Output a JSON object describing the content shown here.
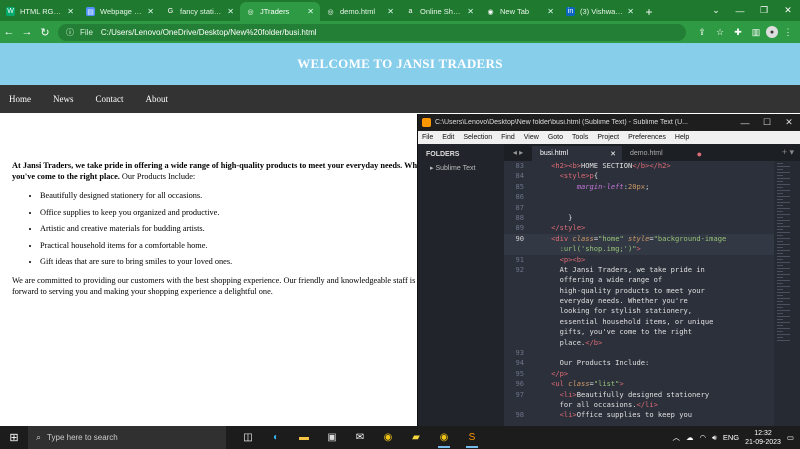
{
  "browser": {
    "tabs": [
      {
        "title": "HTML RGB an",
        "icon": "w3schools-icon",
        "color": "#04aa6d",
        "glyph": "W"
      },
      {
        "title": "Webpage Cre",
        "icon": "doc-icon",
        "color": "#4d90fe",
        "glyph": "▤"
      },
      {
        "title": "fancy statione",
        "icon": "google-icon",
        "color": "#ffffff",
        "glyph": "G"
      },
      {
        "title": "JTraders",
        "icon": "globe-icon",
        "color": "#ffffff",
        "glyph": "◎",
        "active": true
      },
      {
        "title": "demo.html",
        "icon": "globe-icon",
        "color": "#ffffff",
        "glyph": "◎"
      },
      {
        "title": "Online Shopp",
        "icon": "amazon-icon",
        "color": "#ffffff",
        "glyph": "a"
      },
      {
        "title": "New Tab",
        "icon": "chrome-icon",
        "color": "#ffffff",
        "glyph": "◉"
      },
      {
        "title": "(3) Vishwa Ja",
        "icon": "linkedin-icon",
        "color": "#0a66c2",
        "glyph": "in"
      }
    ],
    "new_tab": "+",
    "address": {
      "scheme_label": "File",
      "url": "C:/Users/Lenovo/OneDrive/Desktop/New%20folder/busi.html"
    }
  },
  "site": {
    "banner": "WELCOME TO JANSI TRADERS",
    "nav": [
      "Home",
      "News",
      "Contact",
      "About"
    ],
    "intro_bold": "At Jansi Traders, we take pride in offering a wide range of high-quality products to meet your everyday needs. Whether you're looking for stylish stationery, essential household items, or unique gifts, you've come to the right place.",
    "intro_plain": " Our Products Include:",
    "products": [
      "Beautifully designed stationery for all occasions.",
      "Office supplies to keep you organized and productive.",
      "Artistic and creative materials for budding artists.",
      "Practical household items for a comfortable home.",
      "Gift ideas that are sure to bring smiles to your loved ones."
    ],
    "outro": "We are committed to providing our customers with the best shopping experience. Our friendly and knowledgeable staff is always ready to assist you. Come and explore our diverse selection of products. We look forward to serving you and making your shopping experience a delightful one."
  },
  "editor": {
    "title": "C:\\Users\\Lenovo\\Desktop\\New folder\\busi.html (Sublime Text) - Sublime Text (U...",
    "menu": [
      "File",
      "Edit",
      "Selection",
      "Find",
      "View",
      "Goto",
      "Tools",
      "Project",
      "Preferences",
      "Help"
    ],
    "folders_label": "FOLDERS",
    "folder": "Sublime Text",
    "tabs": [
      {
        "name": "busi.html",
        "active": true
      },
      {
        "name": "demo.html",
        "active": false
      }
    ],
    "lines": [
      {
        "n": "83",
        "html": "    <span class='tg'>&lt;h2&gt;&lt;b&gt;</span>HOME SECTION<span class='tg'>&lt;/b&gt;&lt;/h2&gt;</span>"
      },
      {
        "n": "84",
        "html": "      <span class='tg'>&lt;style&gt;</span><span class='tg'>p</span>{"
      },
      {
        "n": "85",
        "html": "          <span class='pr'>margin-left</span>:<span class='nm'>20px</span>;"
      },
      {
        "n": "86",
        "html": ""
      },
      {
        "n": "87",
        "html": ""
      },
      {
        "n": "88",
        "html": "        }"
      },
      {
        "n": "89",
        "html": "    <span class='tg'>&lt;/style&gt;</span>"
      },
      {
        "n": "90",
        "html": "    <span class='tg'>&lt;div</span> <span class='at'>class</span>=<span class='st'>\"home\"</span> <span class='at'>style</span>=<span class='st'>\"background-image</span>",
        "cur": true
      },
      {
        "n": "",
        "html": "      <span class='st'>:url('shop.img;')</span><span class='st'>\"</span><span class='tg'>&gt;</span>",
        "cur": true
      },
      {
        "n": "91",
        "html": "      <span class='tg'>&lt;p&gt;&lt;b&gt;</span>"
      },
      {
        "n": "92",
        "html": "      At Jansi Traders, we take pride in"
      },
      {
        "n": "",
        "html": "      offering a wide range of"
      },
      {
        "n": "",
        "html": "      high-quality products to meet your"
      },
      {
        "n": "",
        "html": "      everyday needs. Whether you're"
      },
      {
        "n": "",
        "html": "      looking for stylish stationery,"
      },
      {
        "n": "",
        "html": "      essential household items, or unique"
      },
      {
        "n": "",
        "html": "      gifts, you've come to the right"
      },
      {
        "n": "",
        "html": "      place.<span class='tg'>&lt;/b&gt;</span>"
      },
      {
        "n": "93",
        "html": ""
      },
      {
        "n": "94",
        "html": "      Our Products Include:"
      },
      {
        "n": "95",
        "html": "    <span class='tg'>&lt;/p&gt;</span>"
      },
      {
        "n": "96",
        "html": "    <span class='tg'>&lt;ul</span> <span class='at'>class</span>=<span class='st'>\"list\"</span><span class='tg'>&gt;</span>"
      },
      {
        "n": "97",
        "html": "      <span class='tg'>&lt;li&gt;</span>Beautifully designed stationery"
      },
      {
        "n": "",
        "html": "      for all occasions.<span class='tg'>&lt;/li&gt;</span>"
      },
      {
        "n": "98",
        "html": "      <span class='tg'>&lt;li&gt;</span>Office supplies to keep you"
      }
    ]
  },
  "taskbar": {
    "search_placeholder": "Type here to search",
    "apps": [
      "task-view-icon",
      "edge-icon",
      "file-explorer-icon",
      "store-icon",
      "mail-icon",
      "chrome-icon",
      "sticky-notes-icon",
      "chrome-icon",
      "sublime-icon"
    ],
    "language": "ENG",
    "time": "12:32",
    "date": "21-09-2023"
  }
}
